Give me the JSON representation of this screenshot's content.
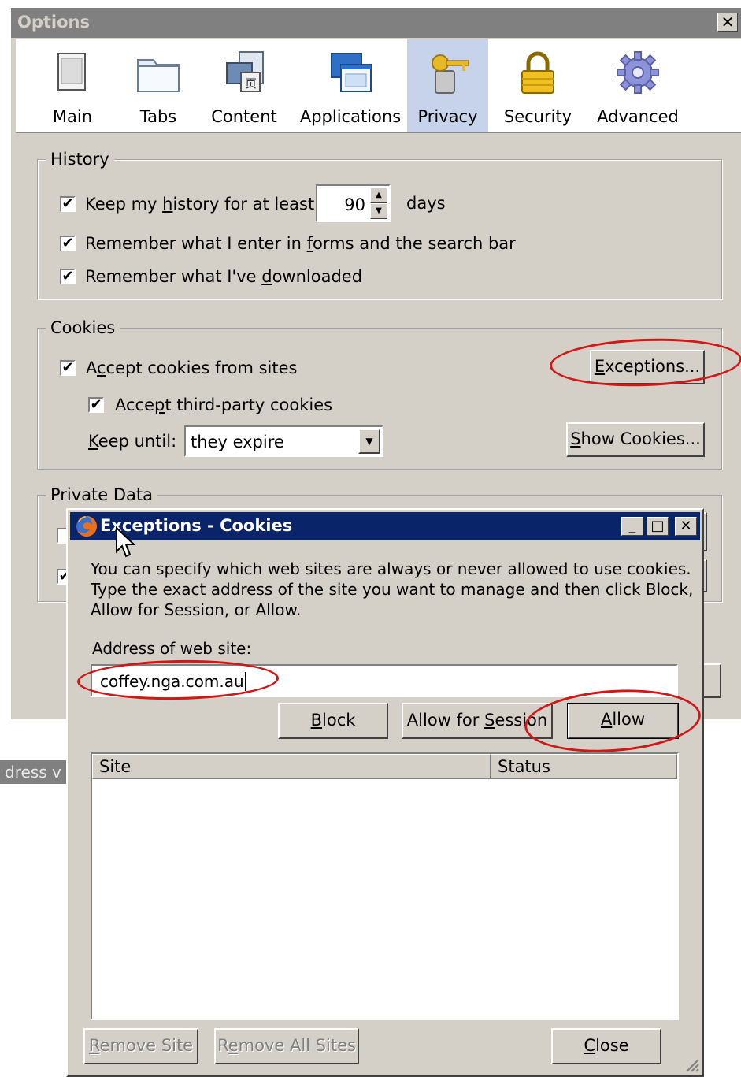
{
  "background": {
    "address_fragment": "dress v"
  },
  "options": {
    "title": "Options",
    "close_glyph": "✕",
    "tabs": [
      {
        "label": "Main",
        "icon": "main-window-icon"
      },
      {
        "label": "Tabs",
        "icon": "tabs-folder-icon"
      },
      {
        "label": "Content",
        "icon": "content-page-icon"
      },
      {
        "label": "Applications",
        "icon": "applications-icon"
      },
      {
        "label": "Privacy",
        "icon": "privacy-key-icon",
        "selected": true
      },
      {
        "label": "Security",
        "icon": "padlock-icon"
      },
      {
        "label": "Advanced",
        "icon": "gear-icon"
      }
    ],
    "history": {
      "legend": "History",
      "keep_history": {
        "pre": "Keep my ",
        "u": "h",
        "post": "istory for at least",
        "checked": true
      },
      "days_value": "90",
      "days_label": "days",
      "remember_forms": {
        "pre": "Remember what I enter in ",
        "u": "f",
        "post": "orms and the search bar",
        "checked": true
      },
      "remember_downloads": {
        "pre": "Remember what I've ",
        "u": "d",
        "post": "ownloaded",
        "checked": true
      }
    },
    "cookies": {
      "legend": "Cookies",
      "accept_cookies": {
        "pre": "A",
        "u": "c",
        "post": "cept cookies from sites",
        "checked": true
      },
      "accept_third_party": {
        "pre": "Acce",
        "u": "p",
        "post": "t third-party cookies",
        "checked": true
      },
      "keep_until": {
        "u": "K",
        "post": "eep until:"
      },
      "keep_until_value": "they expire",
      "exceptions_button": {
        "u": "E",
        "post": "xceptions..."
      },
      "show_cookies_button": {
        "u": "S",
        "post": "how Cookies..."
      }
    },
    "private_data": {
      "legend": "Private Data"
    }
  },
  "exceptions_dialog": {
    "title": "Exceptions - Cookies",
    "window_buttons": {
      "minimize": "_",
      "maximize": "□",
      "close": "✕"
    },
    "description": [
      "You can specify which web sites are always or never allowed to use cookies.",
      "Type the exact address of the site you want to manage and then click Block,",
      "Allow for Session, or Allow."
    ],
    "address_label": "Address of web site:",
    "address_value": "coffey.nga.com.au",
    "block_button": {
      "u": "B",
      "post": "lock"
    },
    "allow_session_button": {
      "pre": "Allow for ",
      "u": "S",
      "post": "ession"
    },
    "allow_button": {
      "u": "A",
      "post": "llow"
    },
    "columns": [
      "Site",
      "Status"
    ],
    "remove_site_button": {
      "u": "R",
      "post": "emove Site"
    },
    "remove_all_button": {
      "pre": "R",
      "u": "e",
      "post": "move All Sites"
    },
    "close_button": {
      "u": "C",
      "post": "lose"
    }
  },
  "colors": {
    "annotation_red": "#d01818",
    "titlebar_active": "#0a246a",
    "dialog_face": "#d4d0c8",
    "selected_tab": "#c6d3ea"
  }
}
